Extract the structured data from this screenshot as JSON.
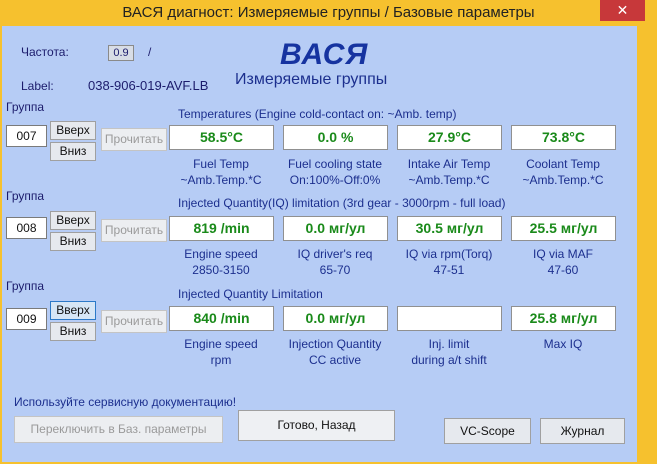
{
  "window": {
    "title": "ВАСЯ диагност: Измеряемые группы / Базовые параметры"
  },
  "header": {
    "freq_label": "Частота:",
    "freq_value": "0.9",
    "freq_sep": "/",
    "label_label": "Label:",
    "label_value": "038-906-019-AVF.LB",
    "brand": "ВАСЯ",
    "subtitle": "Измеряемые группы"
  },
  "groups": [
    {
      "group_label": "Группа",
      "number": "007",
      "up": "Вверх",
      "down": "Вниз",
      "read": "Прочитать",
      "title": "Temperatures (Engine cold-contact on: ~Amb. temp)",
      "fields": [
        {
          "value": "58.5°C",
          "label1": "Fuel Temp",
          "label2": "~Amb.Temp.*C"
        },
        {
          "value": "0.0 %",
          "label1": "Fuel cooling state",
          "label2": "On:100%-Off:0%"
        },
        {
          "value": "27.9°C",
          "label1": "Intake Air Temp",
          "label2": "~Amb.Temp.*C"
        },
        {
          "value": "73.8°C",
          "label1": "Coolant Temp",
          "label2": "~Amb.Temp.*C"
        }
      ]
    },
    {
      "group_label": "Группа",
      "number": "008",
      "up": "Вверх",
      "down": "Вниз",
      "read": "Прочитать",
      "title": "Injected Quantity(IQ) limitation (3rd gear - 3000rpm - full load)",
      "fields": [
        {
          "value": "819 /min",
          "label1": "Engine speed",
          "label2": "2850-3150"
        },
        {
          "value": "0.0 мг/ул",
          "label1": "IQ driver's req",
          "label2": "65-70"
        },
        {
          "value": "30.5 мг/ул",
          "label1": "IQ via rpm(Torq)",
          "label2": "47-51"
        },
        {
          "value": "25.5 мг/ул",
          "label1": "IQ via MAF",
          "label2": "47-60"
        }
      ]
    },
    {
      "group_label": "Группа",
      "number": "009",
      "up": "Вверх",
      "down": "Вниз",
      "read": "Прочитать",
      "title": "Injected Quantity Limitation",
      "fields": [
        {
          "value": "840 /min",
          "label1": "Engine speed",
          "label2": "rpm"
        },
        {
          "value": "0.0 мг/ул",
          "label1": "Injection Quantity",
          "label2": "CC active"
        },
        {
          "value": "",
          "label1": "Inj. limit",
          "label2": "during a/t shift"
        },
        {
          "value": "25.8 мг/ул",
          "label1": "Max IQ",
          "label2": ""
        }
      ]
    }
  ],
  "footer": {
    "advice": "Используйте сервисную документацию!",
    "switch_basic": "Переключить в Баз. параметры",
    "done_back": "Готово, Назад",
    "vc_scope": "VC-Scope",
    "journal": "Журнал"
  }
}
